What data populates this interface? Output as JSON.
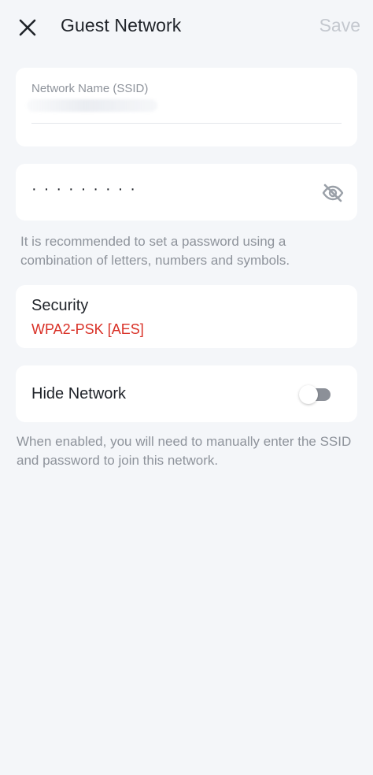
{
  "header": {
    "title": "Guest Network",
    "save_label": "Save",
    "close_icon": "close-icon"
  },
  "ssid": {
    "label": "Network Name (SSID)",
    "value_redacted": true
  },
  "password": {
    "masked_value": "·········",
    "visibility_icon": "eye-off-icon",
    "hint": "It is recommended to set a password using a combination of letters, numbers and symbols."
  },
  "security": {
    "label": "Security",
    "value": "WPA2-PSK [AES]",
    "value_color": "#d93026"
  },
  "hide_network": {
    "label": "Hide Network",
    "enabled": false,
    "hint": "When enabled, you will need to manually enter the SSID and password to join this network."
  },
  "colors": {
    "background": "#f4f6f9",
    "card": "#ffffff",
    "muted_text": "#8e939b",
    "disabled_text": "#c4c8cf",
    "accent_red": "#d93026"
  }
}
